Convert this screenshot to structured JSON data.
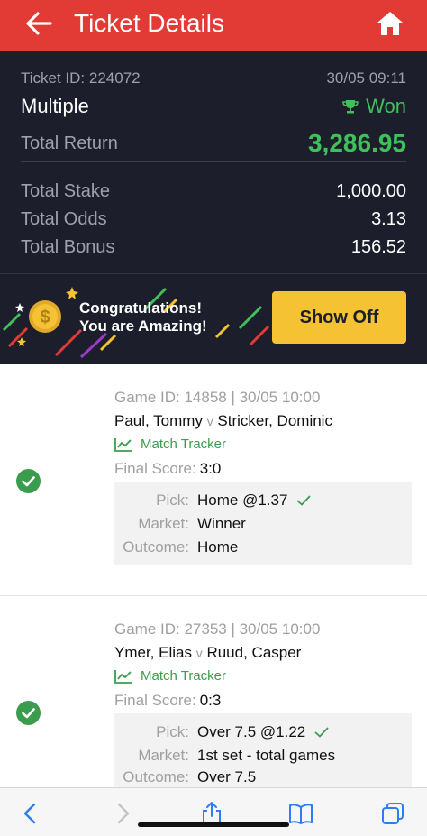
{
  "header": {
    "title": "Ticket Details",
    "back_icon": "arrow-left-icon",
    "home_icon": "home-icon",
    "bg_color": "#e23b35"
  },
  "summary": {
    "ticket_id": "Ticket ID: 224072",
    "datetime": "30/05 09:11",
    "type": "Multiple",
    "status": "Won",
    "total_return_label": "Total Return",
    "total_return": "3,286.95",
    "total_stake_label": "Total Stake",
    "total_stake": "1,000.00",
    "total_odds_label": "Total Odds",
    "total_odds": "3.13",
    "total_bonus_label": "Total Bonus",
    "total_bonus": "156.52",
    "accent_color": "#3fc05a"
  },
  "promo": {
    "line1": "Congratulations!",
    "line2": "You are Amazing!",
    "button": "Show Off",
    "button_color": "#f4c233"
  },
  "bets": [
    {
      "game_id": "Game ID: 14858 | 30/05 10:00",
      "home": "Paul, Tommy",
      "vs": "v",
      "away": "Stricker, Dominic",
      "tracker": "Match Tracker",
      "final_score_label": "Final Score:",
      "final_score": "3:0",
      "pick_label": "Pick:",
      "pick": "Home @1.37",
      "market_label": "Market:",
      "market": "Winner",
      "outcome_label": "Outcome:",
      "outcome": "Home"
    },
    {
      "game_id": "Game ID: 27353 | 30/05 10:00",
      "home": "Ymer, Elias",
      "vs": "v",
      "away": "Ruud, Casper",
      "tracker": "Match Tracker",
      "final_score_label": "Final Score:",
      "final_score": "0:3",
      "pick_label": "Pick:",
      "pick": "Over 7.5 @1.22",
      "market_label": "Market:",
      "market": "1st set - total games",
      "outcome_label": "Outcome:",
      "outcome": "Over 7.5"
    }
  ],
  "browser_bar": {
    "icons": [
      "back-chevron-icon",
      "forward-chevron-icon",
      "share-icon",
      "bookmarks-icon",
      "tabs-icon"
    ],
    "tint_color": "#2f7cf6"
  }
}
